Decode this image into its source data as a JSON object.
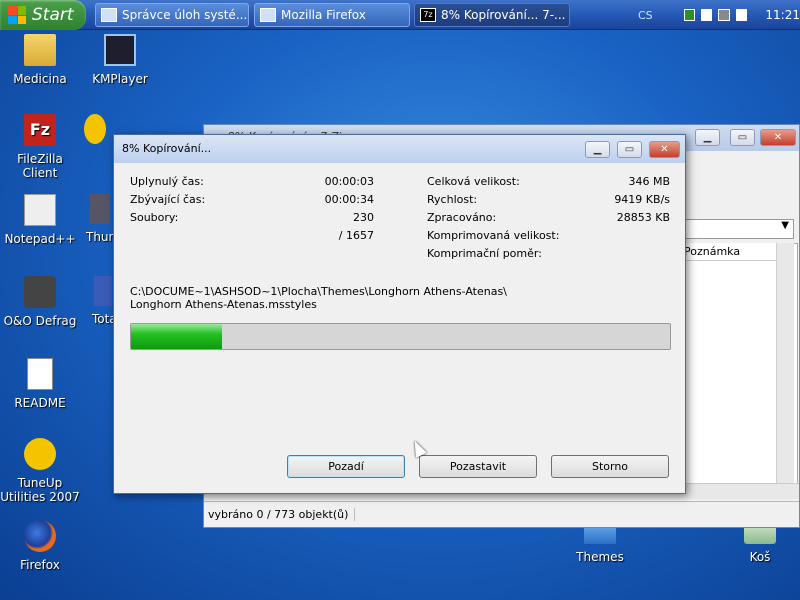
{
  "taskbar": {
    "start_label": "Start",
    "buttons": [
      {
        "label": "Správce úloh systé..."
      },
      {
        "label": "Mozilla Firefox"
      },
      {
        "label": "8% Kopírování... 7-..."
      }
    ],
    "tray": {
      "lang": "CS",
      "time": "11:21"
    }
  },
  "desktop": {
    "icons": [
      {
        "label": "Medicina",
        "icon": "folder-icon"
      },
      {
        "label": "KMPlayer",
        "icon": "kmplayer-icon"
      },
      {
        "label": "FileZilla Client",
        "icon": "filezilla-icon"
      },
      {
        "label": "Notepad++",
        "icon": "notepad-icon"
      },
      {
        "label": "O&O Defrag",
        "icon": "defrag-icon"
      },
      {
        "label": "README",
        "icon": "document-icon"
      },
      {
        "label": "TuneUp Utilities 2007",
        "icon": "tuneup-icon"
      },
      {
        "label": "Firefox",
        "icon": "firefox-icon"
      },
      {
        "label": "Themes",
        "icon": "folder-icon"
      },
      {
        "label": "Koš",
        "icon": "recycle-bin-icon"
      }
    ],
    "partial_labels": [
      "Thun",
      "Tota"
    ]
  },
  "bg_window": {
    "title": "8% Kopírování... 7-Zip",
    "column_header": "Poznámka",
    "status_text": "vybráno 0 / 773 objekt(ů)"
  },
  "dialog": {
    "title": "8% Kopírování...",
    "left": [
      {
        "label": "Uplynulý čas:",
        "value": "00:00:03"
      },
      {
        "label": "Zbývající čas:",
        "value": "00:00:34"
      },
      {
        "label": "Soubory:",
        "value": "230"
      },
      {
        "label": "",
        "value": "/ 1657"
      }
    ],
    "right": [
      {
        "label": "Celková velikost:",
        "value": "346 MB"
      },
      {
        "label": "Rychlost:",
        "value": "9419 KB/s"
      },
      {
        "label": "Zpracováno:",
        "value": "28853 KB"
      },
      {
        "label": "Komprimovaná velikost:",
        "value": ""
      },
      {
        "label": "Komprimační poměr:",
        "value": ""
      }
    ],
    "path_line1": "C:\\DOCUME~1\\ASHSOD~1\\Plocha\\Themes\\Longhorn Athens-Atenas\\",
    "path_line2": "Longhorn Athens-Atenas.msstyles",
    "progress_percent": 8,
    "buttons": {
      "background": "Pozadí",
      "pause": "Pozastavit",
      "cancel": "Storno"
    }
  }
}
